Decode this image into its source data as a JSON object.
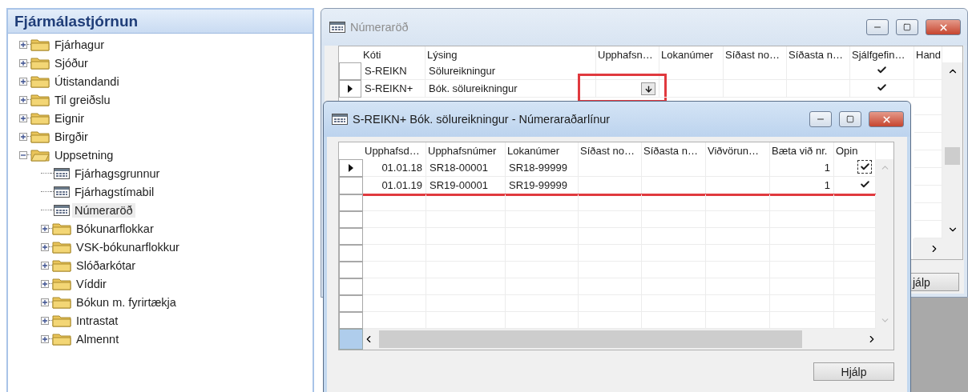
{
  "navigation": {
    "title": "Fjármálastjórnun",
    "tree": [
      {
        "label": "Fjárhagur",
        "kind": "folder",
        "expanded": false,
        "selected": false
      },
      {
        "label": "Sjóður",
        "kind": "folder",
        "expanded": false,
        "selected": false
      },
      {
        "label": "Útistandandi",
        "kind": "folder",
        "expanded": false,
        "selected": false
      },
      {
        "label": "Til greiðslu",
        "kind": "folder",
        "expanded": false,
        "selected": false
      },
      {
        "label": "Eignir",
        "kind": "folder",
        "expanded": false,
        "selected": false
      },
      {
        "label": "Birgðir",
        "kind": "folder",
        "expanded": false,
        "selected": false
      },
      {
        "label": "Uppsetning",
        "kind": "folder",
        "expanded": true,
        "selected": false,
        "children": [
          {
            "label": "Fjárhagsgrunnur",
            "kind": "page",
            "selected": false
          },
          {
            "label": "Fjárhagstímabil",
            "kind": "page",
            "selected": false
          },
          {
            "label": "Númeraröð",
            "kind": "page",
            "selected": true
          },
          {
            "label": "Bókunarflokkar",
            "kind": "folder",
            "expanded": false,
            "selected": false
          },
          {
            "label": "VSK-bókunarflokkur",
            "kind": "folder",
            "expanded": false,
            "selected": false
          },
          {
            "label": "Slóðarkótar",
            "kind": "folder",
            "expanded": false,
            "selected": false
          },
          {
            "label": "Víddir",
            "kind": "folder",
            "expanded": false,
            "selected": false
          },
          {
            "label": "Bókun m. fyrirtækja",
            "kind": "folder",
            "expanded": false,
            "selected": false
          },
          {
            "label": "Intrastat",
            "kind": "folder",
            "expanded": false,
            "selected": false
          },
          {
            "label": "Almennt",
            "kind": "folder",
            "expanded": false,
            "selected": false
          }
        ]
      }
    ]
  },
  "series_window": {
    "title": "Númeraröð",
    "columns": [
      "Kóti",
      "Lýsing",
      "Upphafsn…",
      "Lokanúmer",
      "Síðast no…",
      "Síðasta n…",
      "Sjálfgefin…",
      "Hand"
    ],
    "rows": [
      {
        "current": false,
        "cells": [
          "S-REIKN",
          "Sölureikningur"
        ],
        "lookup": false,
        "highlighted": false,
        "default": true
      },
      {
        "current": true,
        "cells": [
          "S-REIKN+",
          "Bók. sölureikningur"
        ],
        "lookup": true,
        "highlighted": true,
        "default": true
      }
    ],
    "button": "jálp"
  },
  "lines_window": {
    "title": "S-REIKN+ Bók. sölureikningur - Númeraraðarlínur",
    "columns": [
      "Upphafsd…",
      "Upphafsnúmer",
      "Lokanúmer",
      "Síðast no…",
      "Síðasta n…",
      "Viðvörun…",
      "Bæta við nr.",
      "Opin"
    ],
    "rows": [
      {
        "current": true,
        "starting_date": "01.01.18",
        "starting_no": "SR18-00001",
        "ending_no": "SR18-99999",
        "increment": "1",
        "open": true,
        "focused": true,
        "underlined": false
      },
      {
        "current": false,
        "starting_date": "01.01.19",
        "starting_no": "SR19-00001",
        "ending_no": "SR19-99999",
        "increment": "1",
        "open": true,
        "focused": false,
        "underlined": true
      }
    ],
    "button": "Hjálp"
  }
}
